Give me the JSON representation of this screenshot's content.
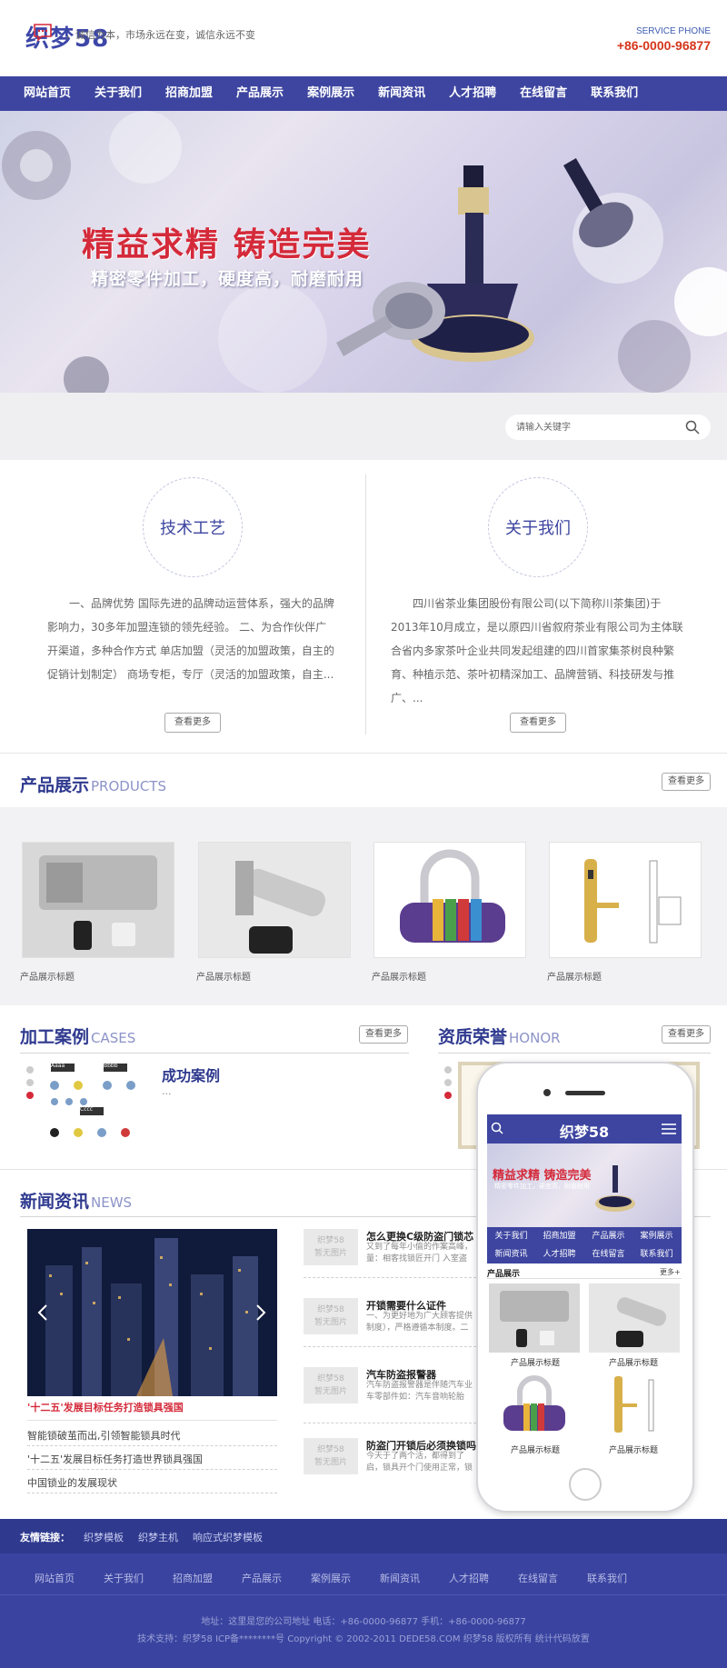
{
  "header": {
    "logo": "织梦58",
    "service_label": "SERVICE PHONE",
    "service_phone": "+86-0000-96877"
  },
  "nav": [
    "网站首页",
    "关于我们",
    "招商加盟",
    "产品展示",
    "案例展示",
    "新闻资讯",
    "人才招聘",
    "在线留言",
    "联系我们"
  ],
  "banner": {
    "slogan": "精益求精  铸造完美",
    "subtitle": "精密零件加工，硬度高，耐磨耐用"
  },
  "notice": {
    "text": "，诚信为本，市场永远在变，诚信永远不变",
    "search_placeholder": "请输入关键字"
  },
  "intro": [
    {
      "title": "技术工艺",
      "text": "一、品牌优势 国际先进的品牌动运营体系，强大的品牌影响力，30多年加盟连锁的领先经验。 二、为合作伙伴广开渠道，多种合作方式 单店加盟（灵活的加盟政策，自主的促销计划制定） 商场专柜，专厅（灵活的加盟政策，自主...",
      "more": "查看更多"
    },
    {
      "title": "关于我们",
      "text": "四川省茶业集团股份有限公司(以下简称川茶集团)于2013年10月成立，是以原四川省叙府茶业有限公司为主体联合省内多家茶叶企业共同发起组建的四川首家集茶树良种繁育、种植示范、茶叶初精深加工、品牌营销、科技研发与推广、...",
      "more": "查看更多"
    }
  ],
  "products": {
    "title": "产品展示",
    "title_en": "PRODUCTS",
    "more": "查看更多",
    "items": [
      "产品展示标题",
      "产品展示标题",
      "产品展示标题",
      "产品展示标题"
    ]
  },
  "cases": {
    "title": "加工案例",
    "title_en": "CASES",
    "more": "查看更多",
    "item_title": "成功案例",
    "item_desc": "...",
    "labels": [
      "Aaaa",
      "Bbbb",
      "Cccc"
    ]
  },
  "honor": {
    "title": "资质荣誉",
    "title_en": "HONOR",
    "more": "查看更多"
  },
  "news": {
    "title": "新闻资讯",
    "title_en": "NEWS",
    "headline": "'十二五'发展目标任务打造锁具强国",
    "list": [
      "智能锁破茧而出,引领智能锁具时代",
      "'十二五'发展目标任务打造世界锁具强国",
      "中国锁业的发展现状"
    ],
    "items": [
      {
        "title": "怎么更换C级防盗门锁芯",
        "desc": "又到了每年小偷的作案高峰，量：相客找锁匠开门 入室盗窃"
      },
      {
        "title": "开锁需要什么证件",
        "desc": "一、为更好地为广大顾客提供制度），严格遵循本制度。二"
      },
      {
        "title": "汽车防盗报警器",
        "desc": "汽车防盗报警器是伴随汽车业车零部件如：汽车音响轮胎"
      },
      {
        "title": "防盗门开锁后必须换锁吗",
        "desc": "今天于了两个活，都得到了启，锁具开个门使用正常，锁"
      }
    ],
    "thumb_line1": "织梦58",
    "thumb_line2": "暂无图片"
  },
  "links": {
    "label": "友情链接：",
    "items": [
      "织梦模板",
      "织梦主机",
      "响应式织梦模板"
    ]
  },
  "footer": {
    "nav": [
      "网站首页",
      "关于我们",
      "招商加盟",
      "产品展示",
      "案例展示",
      "新闻资讯",
      "人才招聘",
      "在线留言",
      "联系我们"
    ],
    "address": "地址：这里是您的公司地址   电话：+86-0000-96877   手机：+86-0000-96877",
    "copyright": "技术支持：织梦58    ICP备********号    Copyright © 2002-2011 DEDE58.COM 织梦58 版权所有     统计代码放置"
  },
  "mobile": {
    "logo": "织梦58",
    "slogan": "精益求精  铸造完美",
    "subtitle": "精密零件加工，硬度高，耐磨耐用",
    "nav": [
      "关于我们",
      "招商加盟",
      "产品展示",
      "案例展示",
      "新闻资讯",
      "人才招聘",
      "在线留言",
      "联系我们"
    ],
    "section": "产品展示",
    "more": "更多+",
    "products": [
      "产品展示标题",
      "产品展示标题",
      "产品展示标题",
      "产品展示标题"
    ]
  },
  "colors": {
    "brand": "#3d45a0",
    "accent_red": "#d42a3a",
    "phone_red": "#d5361b"
  }
}
